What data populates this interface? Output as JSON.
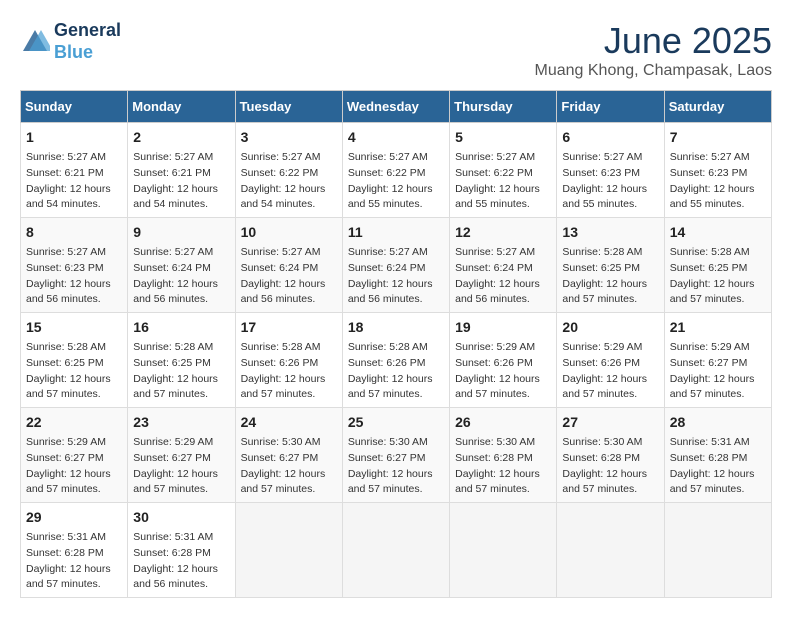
{
  "header": {
    "logo_line1": "General",
    "logo_line2": "Blue",
    "month": "June 2025",
    "location": "Muang Khong, Champasak, Laos"
  },
  "weekdays": [
    "Sunday",
    "Monday",
    "Tuesday",
    "Wednesday",
    "Thursday",
    "Friday",
    "Saturday"
  ],
  "weeks": [
    [
      {
        "day": "1",
        "lines": [
          "Sunrise: 5:27 AM",
          "Sunset: 6:21 PM",
          "Daylight: 12 hours",
          "and 54 minutes."
        ]
      },
      {
        "day": "2",
        "lines": [
          "Sunrise: 5:27 AM",
          "Sunset: 6:21 PM",
          "Daylight: 12 hours",
          "and 54 minutes."
        ]
      },
      {
        "day": "3",
        "lines": [
          "Sunrise: 5:27 AM",
          "Sunset: 6:22 PM",
          "Daylight: 12 hours",
          "and 54 minutes."
        ]
      },
      {
        "day": "4",
        "lines": [
          "Sunrise: 5:27 AM",
          "Sunset: 6:22 PM",
          "Daylight: 12 hours",
          "and 55 minutes."
        ]
      },
      {
        "day": "5",
        "lines": [
          "Sunrise: 5:27 AM",
          "Sunset: 6:22 PM",
          "Daylight: 12 hours",
          "and 55 minutes."
        ]
      },
      {
        "day": "6",
        "lines": [
          "Sunrise: 5:27 AM",
          "Sunset: 6:23 PM",
          "Daylight: 12 hours",
          "and 55 minutes."
        ]
      },
      {
        "day": "7",
        "lines": [
          "Sunrise: 5:27 AM",
          "Sunset: 6:23 PM",
          "Daylight: 12 hours",
          "and 55 minutes."
        ]
      }
    ],
    [
      {
        "day": "8",
        "lines": [
          "Sunrise: 5:27 AM",
          "Sunset: 6:23 PM",
          "Daylight: 12 hours",
          "and 56 minutes."
        ]
      },
      {
        "day": "9",
        "lines": [
          "Sunrise: 5:27 AM",
          "Sunset: 6:24 PM",
          "Daylight: 12 hours",
          "and 56 minutes."
        ]
      },
      {
        "day": "10",
        "lines": [
          "Sunrise: 5:27 AM",
          "Sunset: 6:24 PM",
          "Daylight: 12 hours",
          "and 56 minutes."
        ]
      },
      {
        "day": "11",
        "lines": [
          "Sunrise: 5:27 AM",
          "Sunset: 6:24 PM",
          "Daylight: 12 hours",
          "and 56 minutes."
        ]
      },
      {
        "day": "12",
        "lines": [
          "Sunrise: 5:27 AM",
          "Sunset: 6:24 PM",
          "Daylight: 12 hours",
          "and 56 minutes."
        ]
      },
      {
        "day": "13",
        "lines": [
          "Sunrise: 5:28 AM",
          "Sunset: 6:25 PM",
          "Daylight: 12 hours",
          "and 57 minutes."
        ]
      },
      {
        "day": "14",
        "lines": [
          "Sunrise: 5:28 AM",
          "Sunset: 6:25 PM",
          "Daylight: 12 hours",
          "and 57 minutes."
        ]
      }
    ],
    [
      {
        "day": "15",
        "lines": [
          "Sunrise: 5:28 AM",
          "Sunset: 6:25 PM",
          "Daylight: 12 hours",
          "and 57 minutes."
        ]
      },
      {
        "day": "16",
        "lines": [
          "Sunrise: 5:28 AM",
          "Sunset: 6:25 PM",
          "Daylight: 12 hours",
          "and 57 minutes."
        ]
      },
      {
        "day": "17",
        "lines": [
          "Sunrise: 5:28 AM",
          "Sunset: 6:26 PM",
          "Daylight: 12 hours",
          "and 57 minutes."
        ]
      },
      {
        "day": "18",
        "lines": [
          "Sunrise: 5:28 AM",
          "Sunset: 6:26 PM",
          "Daylight: 12 hours",
          "and 57 minutes."
        ]
      },
      {
        "day": "19",
        "lines": [
          "Sunrise: 5:29 AM",
          "Sunset: 6:26 PM",
          "Daylight: 12 hours",
          "and 57 minutes."
        ]
      },
      {
        "day": "20",
        "lines": [
          "Sunrise: 5:29 AM",
          "Sunset: 6:26 PM",
          "Daylight: 12 hours",
          "and 57 minutes."
        ]
      },
      {
        "day": "21",
        "lines": [
          "Sunrise: 5:29 AM",
          "Sunset: 6:27 PM",
          "Daylight: 12 hours",
          "and 57 minutes."
        ]
      }
    ],
    [
      {
        "day": "22",
        "lines": [
          "Sunrise: 5:29 AM",
          "Sunset: 6:27 PM",
          "Daylight: 12 hours",
          "and 57 minutes."
        ]
      },
      {
        "day": "23",
        "lines": [
          "Sunrise: 5:29 AM",
          "Sunset: 6:27 PM",
          "Daylight: 12 hours",
          "and 57 minutes."
        ]
      },
      {
        "day": "24",
        "lines": [
          "Sunrise: 5:30 AM",
          "Sunset: 6:27 PM",
          "Daylight: 12 hours",
          "and 57 minutes."
        ]
      },
      {
        "day": "25",
        "lines": [
          "Sunrise: 5:30 AM",
          "Sunset: 6:27 PM",
          "Daylight: 12 hours",
          "and 57 minutes."
        ]
      },
      {
        "day": "26",
        "lines": [
          "Sunrise: 5:30 AM",
          "Sunset: 6:28 PM",
          "Daylight: 12 hours",
          "and 57 minutes."
        ]
      },
      {
        "day": "27",
        "lines": [
          "Sunrise: 5:30 AM",
          "Sunset: 6:28 PM",
          "Daylight: 12 hours",
          "and 57 minutes."
        ]
      },
      {
        "day": "28",
        "lines": [
          "Sunrise: 5:31 AM",
          "Sunset: 6:28 PM",
          "Daylight: 12 hours",
          "and 57 minutes."
        ]
      }
    ],
    [
      {
        "day": "29",
        "lines": [
          "Sunrise: 5:31 AM",
          "Sunset: 6:28 PM",
          "Daylight: 12 hours",
          "and 57 minutes."
        ]
      },
      {
        "day": "30",
        "lines": [
          "Sunrise: 5:31 AM",
          "Sunset: 6:28 PM",
          "Daylight: 12 hours",
          "and 56 minutes."
        ]
      },
      {
        "day": "",
        "lines": []
      },
      {
        "day": "",
        "lines": []
      },
      {
        "day": "",
        "lines": []
      },
      {
        "day": "",
        "lines": []
      },
      {
        "day": "",
        "lines": []
      }
    ]
  ]
}
